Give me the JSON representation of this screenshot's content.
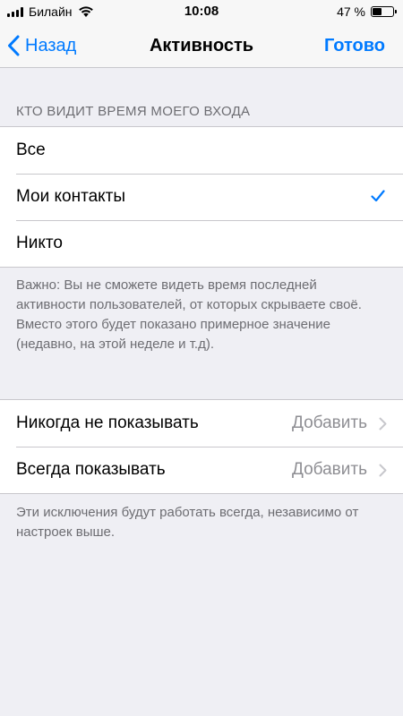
{
  "status_bar": {
    "carrier": "Билайн",
    "time": "10:08",
    "battery_percent": "47 %",
    "battery_level": 0.47
  },
  "nav": {
    "back_label": "Назад",
    "title": "Активность",
    "done_label": "Готово"
  },
  "visibility": {
    "header": "КТО ВИДИТ ВРЕМЯ МОЕГО ВХОДА",
    "options": [
      {
        "label": "Все",
        "selected": false
      },
      {
        "label": "Мои контакты",
        "selected": true
      },
      {
        "label": "Никто",
        "selected": false
      }
    ],
    "note": "Важно: Вы не сможете видеть время последней активности пользователей, от которых скрываете своё. Вместо этого будет показано примерное значение (недавно, на этой неделе и т.д)."
  },
  "exceptions": {
    "rows": [
      {
        "label": "Никогда не показывать",
        "detail": "Добавить"
      },
      {
        "label": "Всегда показывать",
        "detail": "Добавить"
      }
    ],
    "note": "Эти исключения будут работать всегда, независимо от настроек выше."
  },
  "colors": {
    "accent": "#007aff",
    "background": "#efeff4",
    "secondary_text": "#6d6d72"
  }
}
